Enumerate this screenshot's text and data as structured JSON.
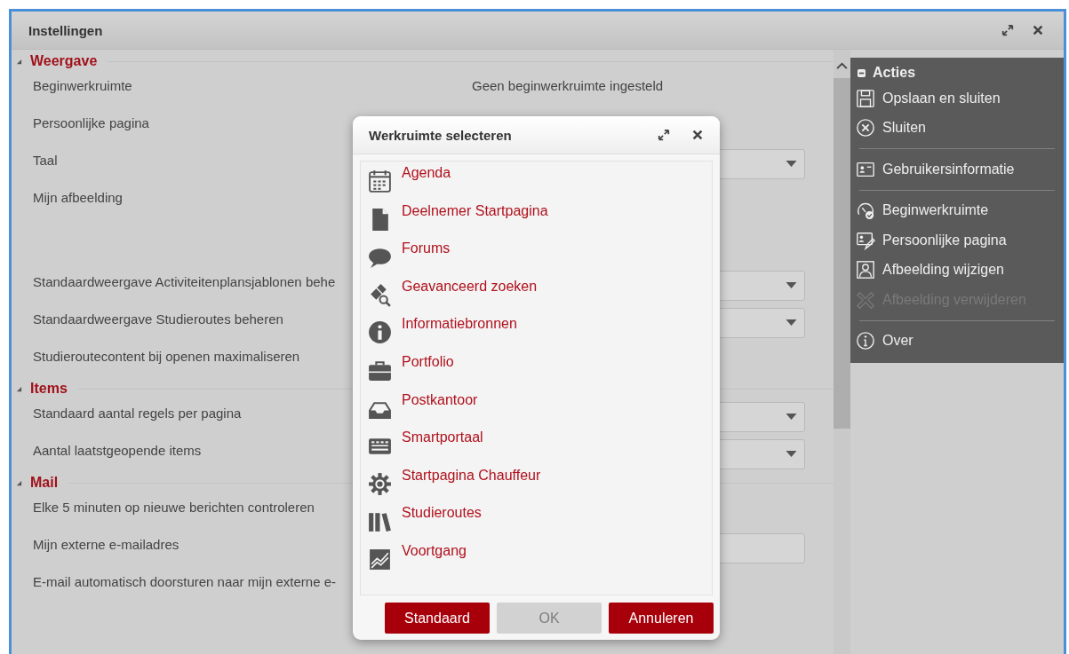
{
  "window": {
    "title": "Instellingen"
  },
  "sections": [
    {
      "title": "Weergave",
      "expanded": true,
      "rows": [
        {
          "label": "Beginwerkruimte",
          "kind": "text",
          "value": "Geen beginwerkruimte ingesteld"
        },
        {
          "label": "Persoonlijke pagina",
          "kind": "plain"
        },
        {
          "label": "Taal",
          "kind": "select"
        },
        {
          "label": "Mijn afbeelding",
          "kind": "image"
        },
        {
          "label": "Standaardweergave Activiteitenplansjablonen behe",
          "kind": "select"
        },
        {
          "label": "Standaardweergave Studieroutes beheren",
          "kind": "select"
        },
        {
          "label": "Studieroutecontent bij openen maximaliseren",
          "kind": "plain"
        }
      ]
    },
    {
      "title": "Items",
      "expanded": true,
      "rows": [
        {
          "label": "Standaard aantal regels per pagina",
          "kind": "select"
        },
        {
          "label": "Aantal laatstgeopende items",
          "kind": "select"
        }
      ]
    },
    {
      "title": "Mail",
      "expanded": true,
      "rows": [
        {
          "label": "Elke 5 minuten op nieuwe berichten controleren",
          "kind": "plain"
        },
        {
          "label": "Mijn externe e-mailadres",
          "kind": "input"
        },
        {
          "label": "E-mail automatisch doorsturen naar mijn externe e-",
          "kind": "plain"
        }
      ]
    }
  ],
  "actions": {
    "title": "Acties",
    "groups": [
      [
        {
          "label": "Opslaan en sluiten",
          "disabled": false
        },
        {
          "label": "Sluiten",
          "disabled": false
        }
      ],
      [
        {
          "label": "Gebruikersinformatie",
          "disabled": false
        }
      ],
      [
        {
          "label": "Beginwerkruimte",
          "disabled": false
        },
        {
          "label": "Persoonlijke pagina",
          "disabled": false
        },
        {
          "label": "Afbeelding wijzigen",
          "disabled": false
        },
        {
          "label": "Afbeelding verwijderen",
          "disabled": true
        }
      ],
      [
        {
          "label": "Over",
          "disabled": false
        }
      ]
    ]
  },
  "dialog": {
    "title": "Werkruimte selecteren",
    "items": [
      "Agenda",
      "Deelnemer Startpagina",
      "Forums",
      "Geavanceerd zoeken",
      "Informatiebronnen",
      "Portfolio",
      "Postkantoor",
      "Smartportaal",
      "Startpagina Chauffeur",
      "Studieroutes",
      "Voortgang"
    ],
    "buttons": [
      {
        "label": "Standaard",
        "disabled": false
      },
      {
        "label": "OK",
        "disabled": true
      },
      {
        "label": "Annuleren",
        "disabled": false
      }
    ]
  }
}
